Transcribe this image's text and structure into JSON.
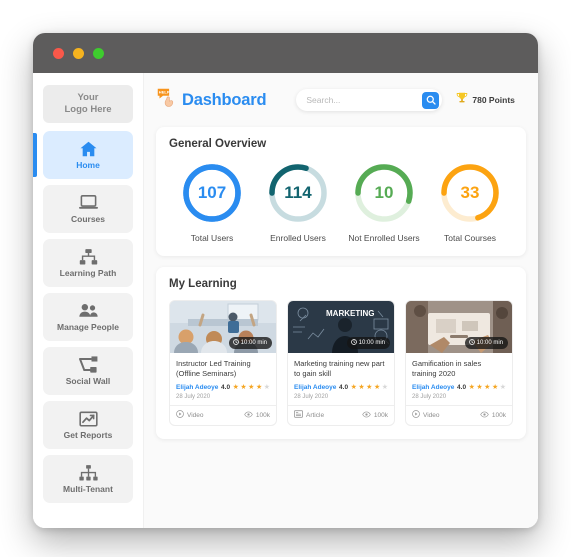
{
  "window": {
    "traffic_lights": [
      "close",
      "minimize",
      "maximize"
    ],
    "colors": {
      "titlebar": "#5d5c5c",
      "accent": "#2a8cf0"
    }
  },
  "sidebar": {
    "logo": {
      "line1": "Your",
      "line2": "Logo Here"
    },
    "items": [
      {
        "label": "Home",
        "icon": "home-icon",
        "active": true
      },
      {
        "label": "Courses",
        "icon": "laptop-icon",
        "active": false
      },
      {
        "label": "Learning Path",
        "icon": "sitemap-icon",
        "active": false
      },
      {
        "label": "Manage People",
        "icon": "people-icon",
        "active": false
      },
      {
        "label": "Social Wall",
        "icon": "share-icon",
        "active": false
      },
      {
        "label": "Get Reports",
        "icon": "chart-line-icon",
        "active": false
      },
      {
        "label": "Multi-Tenant",
        "icon": "hierarchy-icon",
        "active": false
      }
    ]
  },
  "header": {
    "logo_icon": "chat-hand-logo-icon",
    "title": "Dashboard",
    "search": {
      "placeholder": "Search...",
      "value": "",
      "button_icon": "search-icon"
    },
    "points": {
      "icon": "trophy-icon",
      "text": "780 Points"
    }
  },
  "overview": {
    "title": "General Overview",
    "chart_data": {
      "type": "pie",
      "title": "General Overview",
      "legend_position": "below",
      "items": [
        {
          "label": "Total Users",
          "value": 107,
          "percent": 100,
          "color": "#2a8cf0",
          "track": "#2a8cf0"
        },
        {
          "label": "Enrolled Users",
          "value": 114,
          "percent": 30,
          "color": "#12646f",
          "track": "#c7dce0"
        },
        {
          "label": "Not Enrolled Users",
          "value": 10,
          "percent": 55,
          "color": "#56ab54",
          "track": "#dff0de"
        },
        {
          "label": "Total Courses",
          "value": 33,
          "percent": 70,
          "color": "#fca311",
          "track": "#fdecd0"
        }
      ]
    }
  },
  "my_learning": {
    "title": "My Learning",
    "cards": [
      {
        "thumb": "classroom-training-photo",
        "duration": "10:00 min",
        "duration_icon": "clock-icon",
        "title": "Instructor Led Training (Offline Seminars)",
        "author": "Elijah Adeoye",
        "rating": "4.0",
        "stars_filled": 4,
        "stars_total": 5,
        "date": "28 July 2020",
        "type": "Video",
        "type_icon": "play-icon",
        "views": "100k",
        "views_icon": "eye-icon"
      },
      {
        "thumb": "marketing-blackboard-photo",
        "duration": "10:00 min",
        "duration_icon": "clock-icon",
        "title": "Marketing training new part to gain skill",
        "author": "Elijah Adeoye",
        "rating": "4.0",
        "stars_filled": 4,
        "stars_total": 5,
        "date": "28 July 2020",
        "type": "Article",
        "type_icon": "article-icon",
        "views": "100k",
        "views_icon": "eye-icon"
      },
      {
        "thumb": "team-desk-meeting-photo",
        "duration": "10:00 min",
        "duration_icon": "clock-icon",
        "title": "Gamification in sales training 2020",
        "author": "Elijah Adeoye",
        "rating": "4.0",
        "stars_filled": 4,
        "stars_total": 5,
        "date": "28 July 2020",
        "type": "Video",
        "type_icon": "play-icon",
        "views": "100k",
        "views_icon": "eye-icon"
      }
    ]
  }
}
